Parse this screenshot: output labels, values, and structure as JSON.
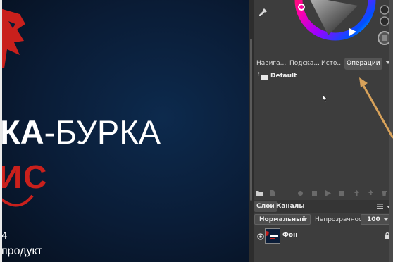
{
  "image": {
    "headline_bold": "КА",
    "headline_rest": "-БУРКА",
    "red_letters": "ИС",
    "line_a": "4",
    "line_b": "продукт"
  },
  "color_panel": {
    "eyedropper_icon": "eyedropper-icon",
    "wheel_icon": "hue-wheel"
  },
  "docker_tabs": [
    {
      "label": "Навига..."
    },
    {
      "label": "Подска..."
    },
    {
      "label": "Исто..."
    },
    {
      "label": "Операции"
    }
  ],
  "operations": {
    "folder_label": "Default"
  },
  "layers": {
    "tabs": [
      {
        "label": "Слои"
      },
      {
        "label": "Каналы"
      }
    ],
    "blend_mode": "Нормальный",
    "opacity_label": "Непрозрачность",
    "opacity_value": "100",
    "layer_name": "Фон"
  },
  "colors": {
    "annotation_arrow": "#d8a25a",
    "logo_red": "#c9201c",
    "panel_bg": "#3d3d3d"
  }
}
